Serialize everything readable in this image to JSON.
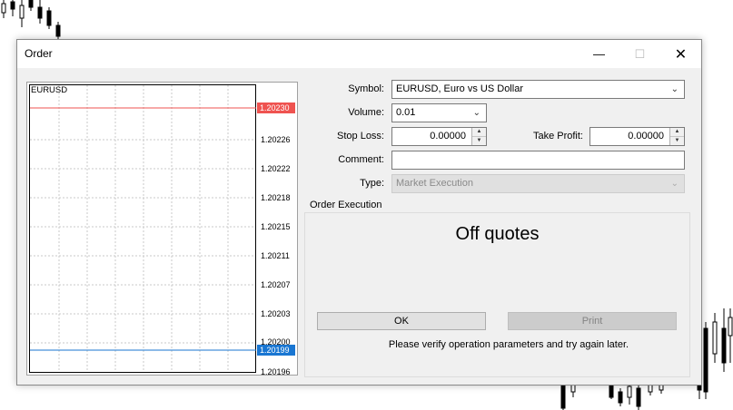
{
  "window": {
    "title": "Order",
    "minimize_glyph": "—",
    "maximize_glyph": "☐",
    "close_glyph": "✕"
  },
  "chart": {
    "symbol": "EURUSD",
    "price_levels": [
      "1.20226",
      "1.20222",
      "1.20218",
      "1.20215",
      "1.20211",
      "1.20207",
      "1.20203",
      "1.20200",
      "1.20196"
    ],
    "ask_label": "1.20230",
    "bid_label": "1.20199",
    "ask_color": "#ef5350",
    "bid_color": "#1976d2"
  },
  "form": {
    "symbol_label": "Symbol:",
    "symbol_value": "EURUSD, Euro vs US Dollar",
    "volume_label": "Volume:",
    "volume_value": "0.01",
    "stop_loss_label": "Stop Loss:",
    "stop_loss_value": "0.00000",
    "take_profit_label": "Take Profit:",
    "take_profit_value": "0.00000",
    "comment_label": "Comment:",
    "comment_value": "",
    "type_label": "Type:",
    "type_value": "Market Execution"
  },
  "execution": {
    "group_label": "Order Execution",
    "status_text": "Off quotes",
    "ok_label": "OK",
    "print_label": "Print",
    "message": "Please verify operation parameters and try again later."
  }
}
